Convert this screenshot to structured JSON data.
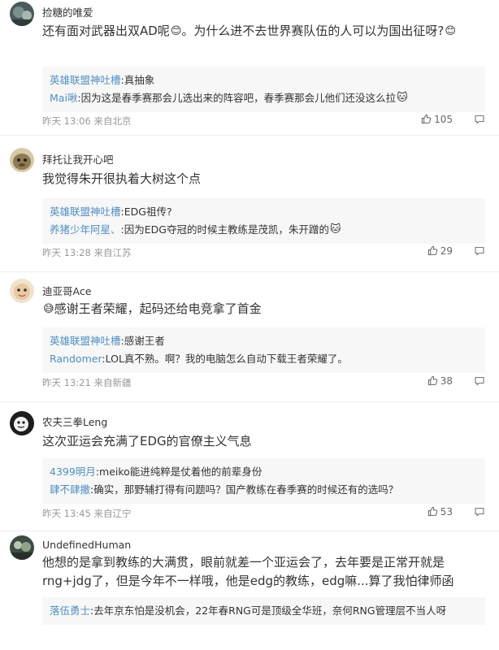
{
  "comments": [
    {
      "user": "捡糖的唯爱",
      "text": "还有面对武器出双AD呢",
      "text_emoji": "😊",
      "text_more": "。为什么进不去世界赛队伍的人可以为国出征呀?",
      "text_emoji_2": "😊",
      "replies": [
        {
          "name": "英雄联盟神吐槽",
          "text": "真抽象"
        },
        {
          "name": "Mai啾",
          "text": "因为这是春季赛那会儿选出来的阵容吧，春季赛那会儿他们还没这么拉",
          "emoji": "🐱"
        }
      ],
      "time": "昨天 13:06",
      "source": "来自北京",
      "likes": "105"
    },
    {
      "user": "拜托让我开心吧",
      "text": "我觉得朱开很执着大树这个点",
      "replies": [
        {
          "name": "英雄联盟神吐槽",
          "text": "EDG祖传?"
        },
        {
          "name": "养猪少年阿星、",
          "text": "因为EDG夺冠的时候主教练是茂凯，朱开蹭的",
          "emoji": "🐱"
        }
      ],
      "time": "昨天 13:28",
      "source": "来自江苏",
      "likes": "29"
    },
    {
      "user": "迪亚哥Ace",
      "text_emoji_prefix": "😅",
      "text": "感谢王者荣耀，起码还给电竞拿了首金",
      "replies": [
        {
          "name": "英雄联盟神吐槽",
          "text": "感谢王者"
        },
        {
          "name": "Randomer",
          "text": "LOL真不熟。啊？我的电脑怎么自动下载王者荣耀了。"
        }
      ],
      "time": "昨天 13:21",
      "source": "来自新疆",
      "likes": "38"
    },
    {
      "user": "农夫三拳Leng",
      "text": "这次亚运会充满了EDG的官僚主义气息",
      "replies": [
        {
          "name": "4399明月",
          "text": "meiko能进纯粹是仗着他的前辈身份"
        },
        {
          "name": "肆不肆撒",
          "text": "确实，那野辅打得有问题吗？国产教练在春季赛的时候还有的选吗？"
        }
      ],
      "time": "昨天 13:45",
      "source": "来自辽宁",
      "likes": "53"
    },
    {
      "user": "UndefinedHuman",
      "text": "他想的是拿到教练的大满贯，眼前就差一个亚运会了，去年要是正常开就是rng+jdg了，但是今年不一样哦，他是edg的教练，edg嘛...算了我怕律师函",
      "replies": [
        {
          "name": "落伍勇士",
          "text": "去年京东怕是没机会，22年春RNG可是顶级全华班，奈何RNG管理层不当人呀"
        }
      ]
    }
  ],
  "colors": {
    "link": "#4f8fc4",
    "reply_bg": "#f7f7f7",
    "meta": "#999999",
    "divider": "#eeeeee"
  },
  "icons": {
    "like": "thumbs-up-icon",
    "reply": "comment-bubble-icon"
  }
}
